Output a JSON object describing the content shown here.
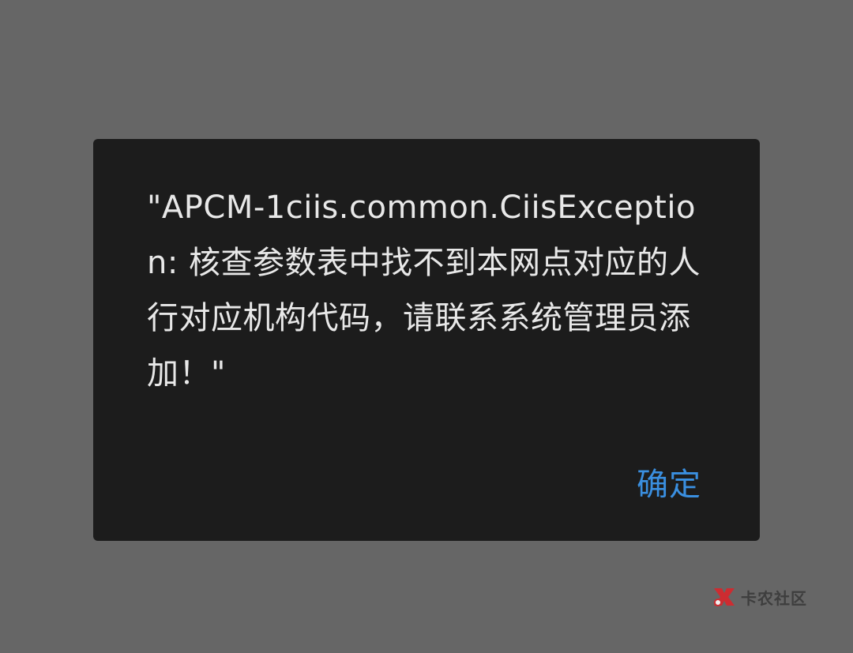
{
  "dialog": {
    "message": "\"APCM-1ciis.common.CiisException: 核查参数表中找不到本网点对应的人行对应机构代码，请联系系统管理员添加！\"",
    "confirm_label": "确定"
  },
  "watermark": {
    "text": "卡农社区"
  },
  "colors": {
    "scrim": "#666666",
    "dialog_bg": "#1c1c1c",
    "message_text": "#e8e8e8",
    "confirm_text": "#3a8fe0",
    "logo_red": "#d9262c"
  }
}
